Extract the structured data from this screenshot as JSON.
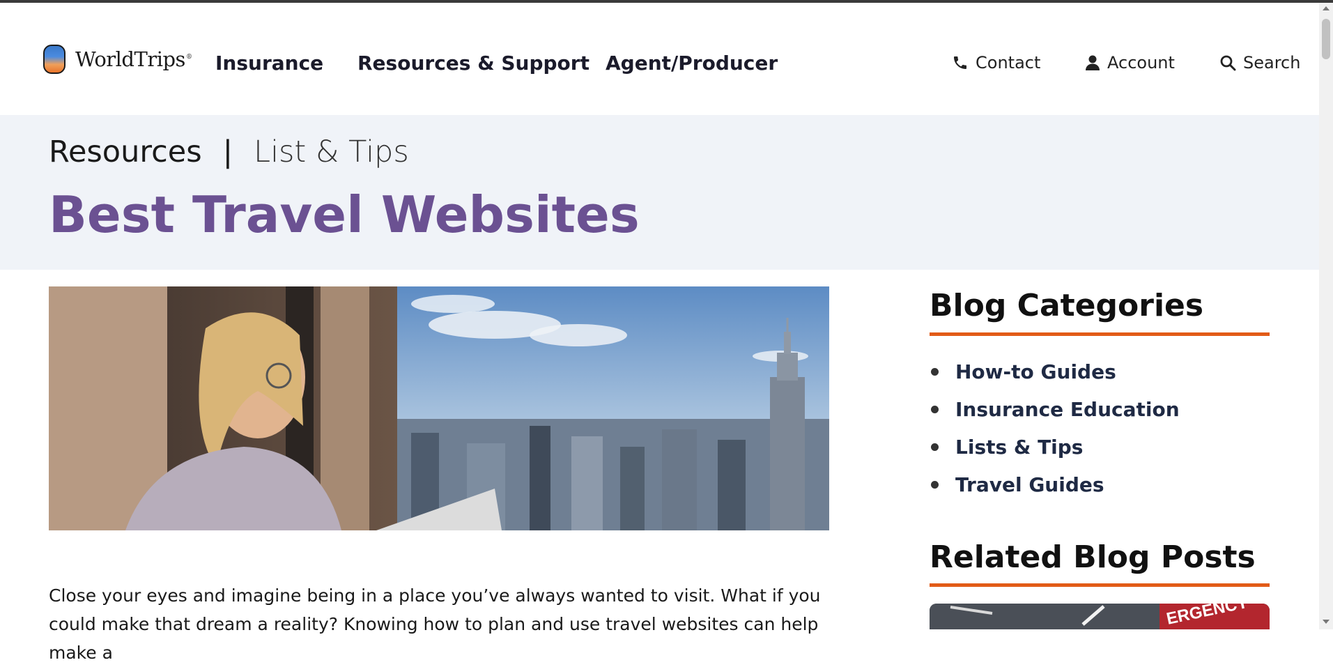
{
  "brand": {
    "name": "WorldTrips",
    "reg_mark": "®"
  },
  "nav": {
    "insurance": "Insurance",
    "resources": "Resources & Support",
    "agent": "Agent/Producer"
  },
  "utility": {
    "contact": "Contact",
    "account": "Account",
    "search": "Search"
  },
  "breadcrumb": {
    "parent": "Resources",
    "separator": "|",
    "current": "List & Tips"
  },
  "page": {
    "title": "Best Travel Websites"
  },
  "hero": {
    "alt": "woman-looking-out-window-at-city-skyline"
  },
  "article": {
    "intro": "Close your eyes and imagine being in a place you’ve always wanted to visit. What if you could make that dream a reality? Knowing how to plan and use travel websites can help make a"
  },
  "sidebar": {
    "categories_heading": "Blog Categories",
    "categories": [
      "How-to Guides",
      "Insurance Education",
      "Lists & Tips",
      "Travel Guides"
    ],
    "related_heading": "Related Blog Posts",
    "related_thumb_text": "ERGENCY"
  },
  "colors": {
    "title_purple": "#6b5192",
    "accent_orange": "#e25b17",
    "banner_bg": "#f0f3f8"
  },
  "icons": {
    "contact": "phone-icon",
    "account": "user-icon",
    "search": "search-icon"
  }
}
